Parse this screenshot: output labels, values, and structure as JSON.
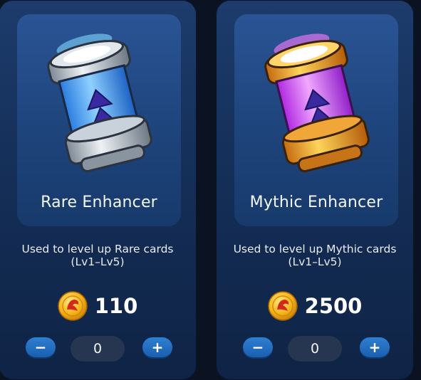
{
  "cards": [
    {
      "title": "Rare Enhancer",
      "description": "Used to level up Rare cards (Lv1–Lv5)",
      "price": "110",
      "quantity": "0",
      "decrement_label": "−",
      "increment_label": "+",
      "icon": "rare-enhancer-canister",
      "accent_color": "#4aa3ff"
    },
    {
      "title": "Mythic Enhancer",
      "description": "Used to level up Mythic cards (Lv1–Lv5)",
      "price": "2500",
      "quantity": "0",
      "decrement_label": "−",
      "increment_label": "+",
      "icon": "mythic-enhancer-canister",
      "accent_color": "#c040f0"
    }
  ],
  "currency_icon": "dragon-coin-icon"
}
